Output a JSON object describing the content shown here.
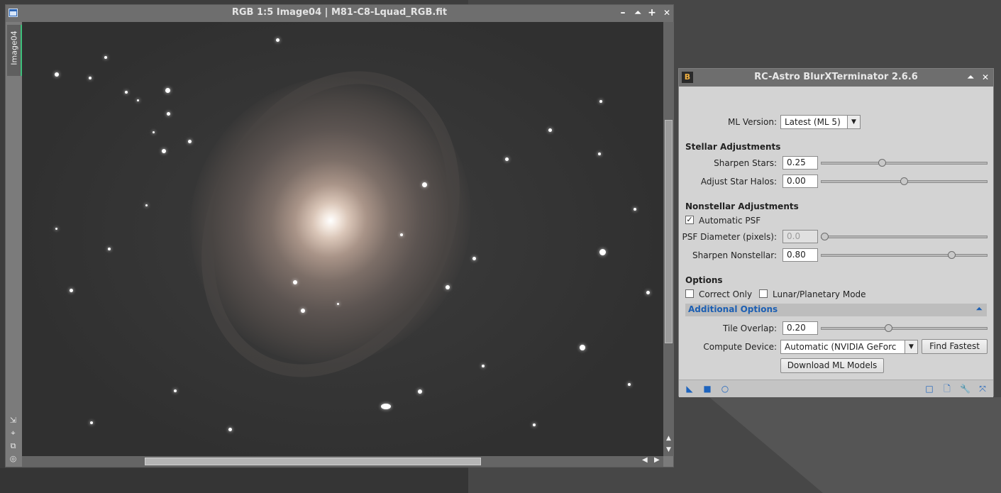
{
  "image_window": {
    "title": "RGB 1:5 Image04 | M81-C8-Lquad_RGB.fit",
    "side_tab": "Image04",
    "controls": {
      "minimize": "–",
      "shade": "⏶",
      "maximize": "+",
      "close": "✕"
    }
  },
  "blurx": {
    "badge": "B",
    "title": "RC-Astro BlurXTerminator 2.6.6",
    "title_controls": {
      "shade": "⏶",
      "close": "✕"
    },
    "ml_version": {
      "label": "ML Version:",
      "value": "Latest (ML 5)"
    },
    "stellar": {
      "heading": "Stellar Adjustments",
      "sharpen_stars": {
        "label": "Sharpen Stars:",
        "value": "0.25",
        "level": 0.36
      },
      "adjust_halos": {
        "label": "Adjust Star Halos:",
        "value": "0.00",
        "level": 0.5
      }
    },
    "nonstellar": {
      "heading": "Nonstellar Adjustments",
      "automatic_psf": {
        "label": "Automatic PSF",
        "checked": true
      },
      "psf_diameter": {
        "label": "PSF Diameter (pixels):",
        "value": "0.0",
        "level": 0.0
      },
      "sharpen_nonstellar": {
        "label": "Sharpen Nonstellar:",
        "value": "0.80",
        "level": 0.8
      }
    },
    "options": {
      "heading": "Options",
      "correct_only": {
        "label": "Correct Only",
        "checked": false
      },
      "lunar_planetary": {
        "label": "Lunar/Planetary Mode",
        "checked": false
      }
    },
    "additional": {
      "heading": "Additional Options",
      "tile_overlap": {
        "label": "Tile Overlap:",
        "value": "0.20",
        "level": 0.4
      },
      "compute_device": {
        "label": "Compute Device:",
        "value": "Automatic (NVIDIA GeForc"
      },
      "find_fastest": "Find Fastest",
      "download": "Download ML Models"
    }
  },
  "icons": [
    "minimize-icon",
    "shade-icon",
    "maximize-icon",
    "close-icon",
    "new-instance-icon",
    "apply-global-icon",
    "apply-icon",
    "reset-icon",
    "browse-doc-icon",
    "preferences-icon",
    "expand-icon"
  ],
  "colors": {
    "accent": "#1c5fb3",
    "tab_marker": "#3dbf7b"
  }
}
